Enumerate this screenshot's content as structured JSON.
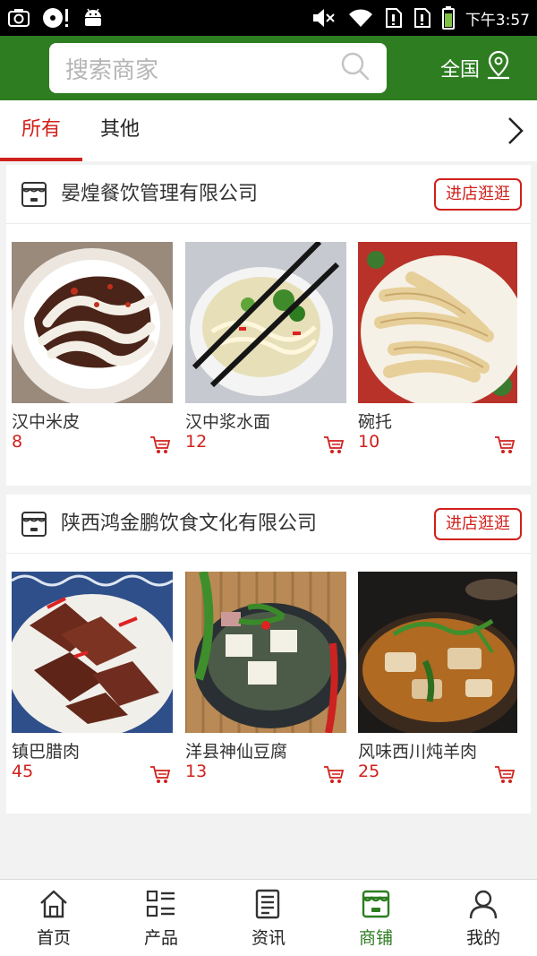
{
  "status_bar": {
    "time": "下午3:57",
    "left_icons": [
      "screenshot-icon",
      "media-icon",
      "android-icon"
    ],
    "right_icons": [
      "mute-icon",
      "wifi-icon",
      "sim1-icon",
      "sim2-icon",
      "battery-icon"
    ]
  },
  "header": {
    "search_placeholder": "搜索商家",
    "region_label": "全国",
    "accent_color": "#2e7d21"
  },
  "tabs": [
    {
      "label": "所有",
      "active": true
    },
    {
      "label": "其他",
      "active": false
    }
  ],
  "shops": [
    {
      "name": "晏煌餐饮管理有限公司",
      "visit_label": "进店逛逛",
      "products": [
        {
          "name": "汉中米皮",
          "price": "8"
        },
        {
          "name": "汉中浆水面",
          "price": "12"
        },
        {
          "name": "碗托",
          "price": "10"
        }
      ]
    },
    {
      "name": "陕西鸿金鹏饮食文化有限公司",
      "visit_label": "进店逛逛",
      "products": [
        {
          "name": "镇巴腊肉",
          "price": "45"
        },
        {
          "name": "洋县神仙豆腐",
          "price": "13"
        },
        {
          "name": "风味西川炖羊肉",
          "price": "25"
        }
      ]
    }
  ],
  "bottom_nav": [
    {
      "label": "首页",
      "icon": "home-icon",
      "active": false
    },
    {
      "label": "产品",
      "icon": "products-icon",
      "active": false
    },
    {
      "label": "资讯",
      "icon": "news-icon",
      "active": false
    },
    {
      "label": "商铺",
      "icon": "shop-icon",
      "active": true
    },
    {
      "label": "我的",
      "icon": "user-icon",
      "active": false
    }
  ],
  "colors": {
    "price": "#d0201b",
    "active_tab": "#d0201b",
    "active_nav": "#2e7d21"
  }
}
